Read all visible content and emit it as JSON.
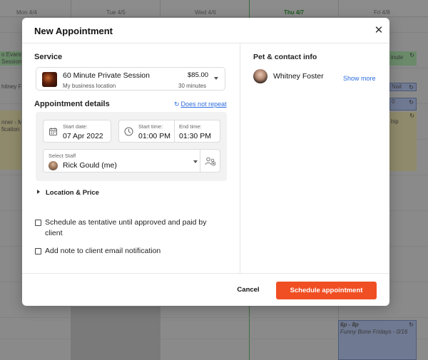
{
  "calendar": {
    "days": [
      "Mon 4/4",
      "Tue 4/5",
      "Wed 4/6",
      "Thu 4/7",
      "Fri 4/8"
    ],
    "left_events": [
      "o Evans -",
      "Session",
      "hitney Fo",
      "nner - M",
      "fication"
    ],
    "right_events": [
      "inute",
      "Nail",
      "0",
      "hip"
    ],
    "bottom_event": {
      "time": "6p - 8p",
      "title": "Funny Bone Fridays - 0/16"
    }
  },
  "modal": {
    "title": "New Appointment",
    "close_glyph": "✕",
    "service": {
      "label": "Service",
      "name": "60 Minute Private Session",
      "location": "My business location",
      "price": "$85.00",
      "duration": "30 minutes"
    },
    "details": {
      "label": "Appointment details",
      "repeat_icon": "↻",
      "repeat": "Does not repeat",
      "start_date_label": "Start date:",
      "start_date": "07 Apr 2022",
      "start_time_label": "Start time:",
      "start_time": "01:00 PM",
      "end_time_label": "End time:",
      "end_time": "01:30 PM",
      "staff_label": "Select Staff",
      "staff": "Rick Gould (me)"
    },
    "location_price": "Location & Price",
    "checks": {
      "tentative_line1": "Schedule as tentative until approved and paid by",
      "tentative_line2": "client",
      "note": "Add note to client email notification"
    },
    "contact": {
      "title": "Pet & contact info",
      "client": "Whitney Foster",
      "show_more": "Show more"
    },
    "footer": {
      "cancel": "Cancel",
      "schedule": "Schedule appointment"
    }
  },
  "colors": {
    "accent": "#f04f23",
    "link": "#2d6cdf",
    "today": "#1d5a1d"
  }
}
